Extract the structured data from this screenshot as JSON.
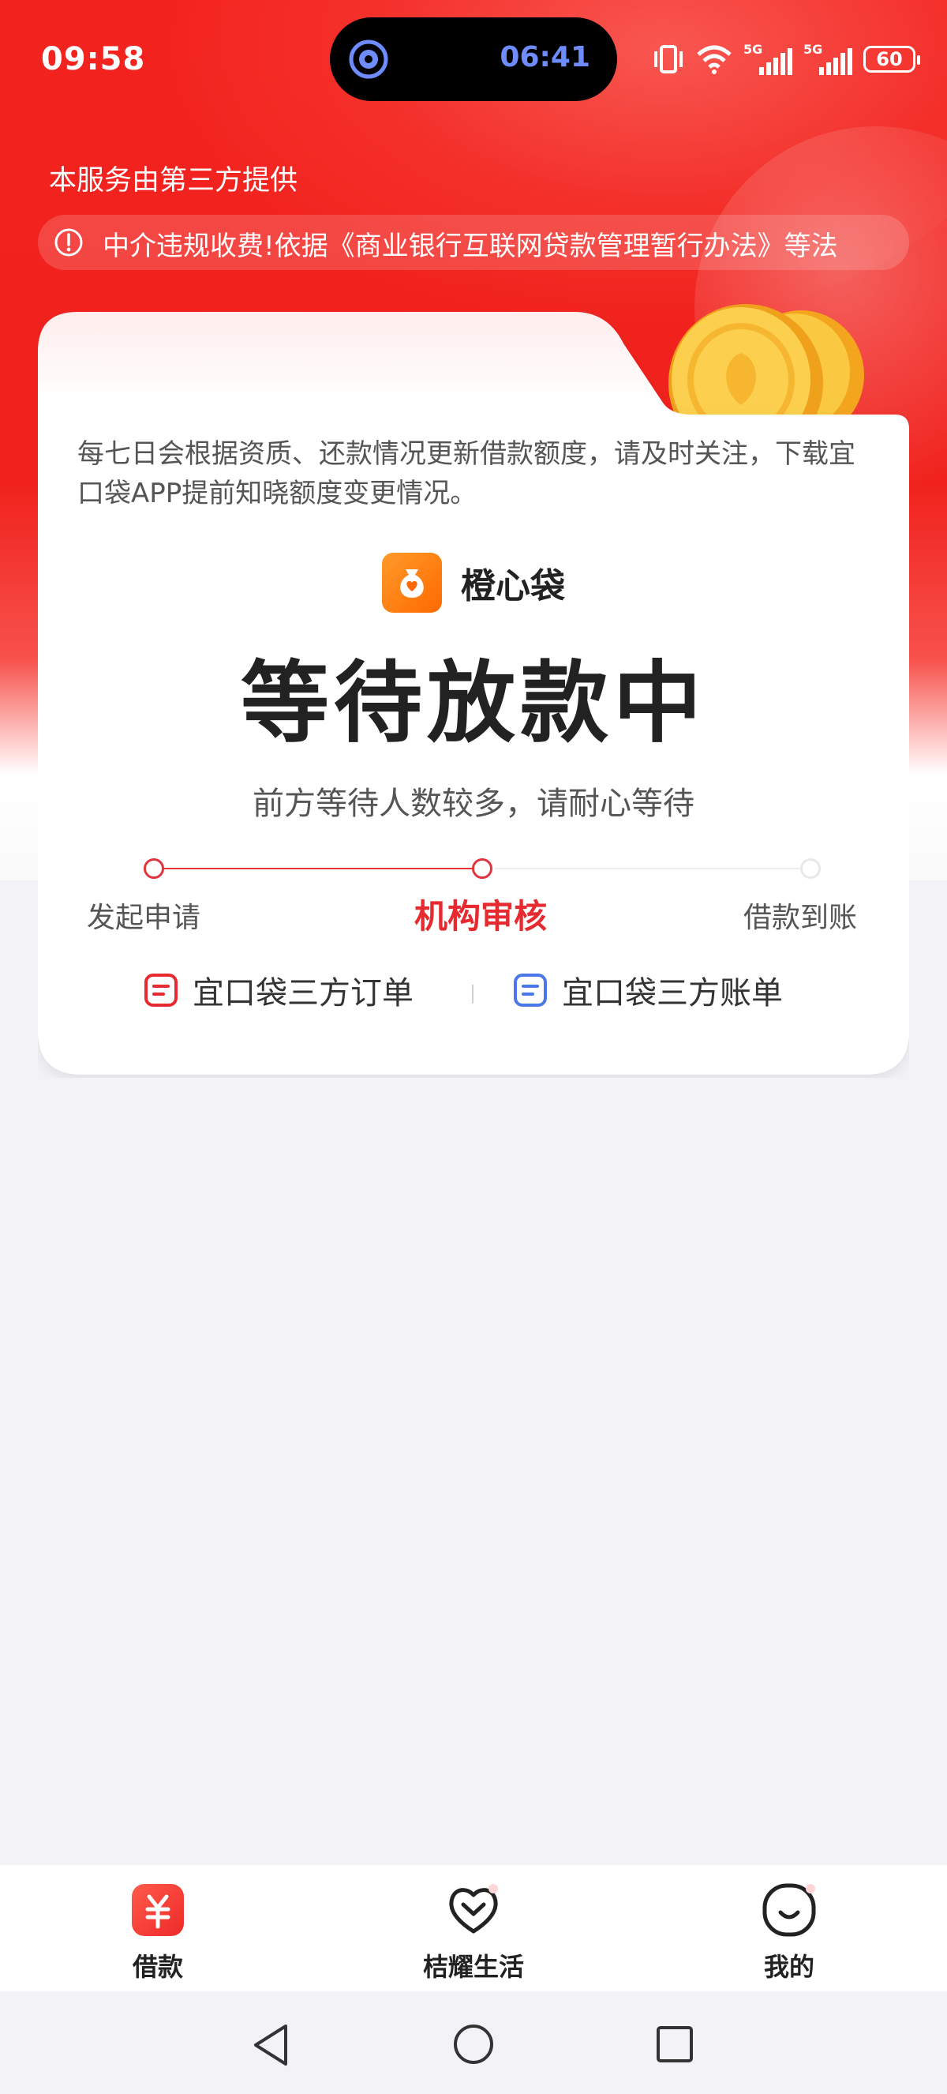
{
  "status": {
    "time": "09:58",
    "island_time": "06:41",
    "network": "5G",
    "battery": "60"
  },
  "header": {
    "provider": "本服务由第三方提供",
    "notice": "中介违规收费!依据《商业银行互联网贷款管理暂行办法》等法"
  },
  "card": {
    "description": "每七日会根据资质、还款情况更新借款额度，请及时关注，下载宜口袋APP提前知晓额度变更情况。",
    "brand_name": "橙心袋",
    "headline": "等待放款中",
    "subline": "前方等待人数较多，请耐心等待",
    "steps": [
      {
        "label": "发起申请",
        "state": "done"
      },
      {
        "label": "机构审核",
        "state": "active"
      },
      {
        "label": "借款到账",
        "state": "pending"
      }
    ],
    "links": {
      "order": "宜口袋三方订单",
      "bill": "宜口袋三方账单"
    }
  },
  "tabs": [
    {
      "label": "借款",
      "active": true
    },
    {
      "label": "桔耀生活",
      "active": false
    },
    {
      "label": "我的",
      "active": false
    }
  ],
  "colors": {
    "brand_red": "#f3231f",
    "accent_red": "#e62a2f",
    "blue": "#4a78e8"
  }
}
